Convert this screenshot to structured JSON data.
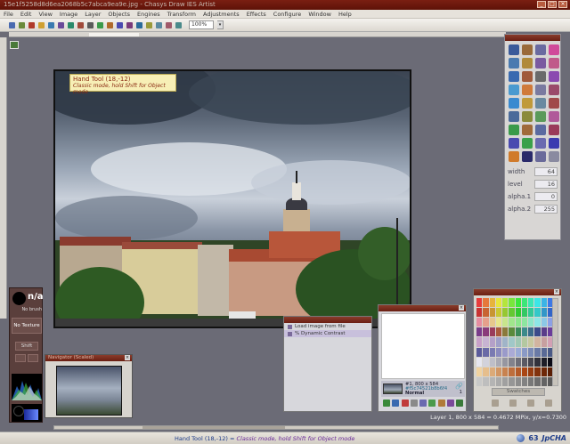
{
  "app": {
    "title": "15e1f5258d8d6ea2068b5c7abca9ea9e.jpg - Chasys Draw IES Artist",
    "window_buttons": [
      "_",
      "□",
      "×"
    ]
  },
  "menu": [
    "File",
    "Edit",
    "View",
    "Image",
    "Layer",
    "Objects",
    "Engines",
    "Transform",
    "Adjustments",
    "Effects",
    "Configure",
    "Window",
    "Help"
  ],
  "toolbar": {
    "zoom": "100%",
    "button_colors": [
      "#4a6ab0",
      "#6a8a3a",
      "#b03a2a",
      "#d0a030",
      "#3a7ab0",
      "#6a4a9a",
      "#2a8a6a",
      "#a04a3a",
      "#5a5a5a",
      "#3a9a4a",
      "#b06a2a",
      "#4a4ab0",
      "#7a3a7a",
      "#2a6a9a",
      "#9a9a3a",
      "#5a8aa0",
      "#a05a6a",
      "#4a8a8a"
    ]
  },
  "tooltip": {
    "title": "Hand Tool (18,-12)",
    "hint": "Classic mode, hold Shift for Object mode"
  },
  "tools": {
    "icon_colors": [
      "#3a5a9a",
      "#9a6a3a",
      "#6a6aa0",
      "#d04a9a",
      "#4a7ab0",
      "#b08a3a",
      "#7a5aa0",
      "#c05a8a",
      "#3a6ab0",
      "#a05a3a",
      "#6a6a6a",
      "#8a4ab0",
      "#4a9ad0",
      "#d07a3a",
      "#7a7aa0",
      "#9a4a6a",
      "#3a8ad0",
      "#c09a3a",
      "#6a8aa0",
      "#a04a4a",
      "#4a6a9a",
      "#8a8a3a",
      "#5a9a5a",
      "#b05a9a",
      "#3a9a4a",
      "#a06a3a",
      "#5a6aa0",
      "#9a3a5a",
      "#4a4ab0",
      "#3aa04a",
      "#6a6ab0",
      "#3a3ab0",
      "#d07a2a",
      "#2a2a6a",
      "#6a6a9a",
      "#8a8aa0"
    ],
    "params": [
      {
        "label": "width",
        "value": "64"
      },
      {
        "label": "level",
        "value": "16"
      },
      {
        "label": "alpha.1",
        "value": "0"
      },
      {
        "label": "alpha.2",
        "value": "255"
      }
    ]
  },
  "brush": {
    "name": "n/a",
    "status": "No brush",
    "texture": "No Texture",
    "shift_label": "Shift"
  },
  "preview": {
    "title": "Navigator (Scaled)"
  },
  "history": {
    "items": [
      "Load image from file",
      "% Dynamic Contrast"
    ]
  },
  "layers": {
    "entry_id": "#1, 800 x 584",
    "entry_hash": "#f5c74521b8b6f4",
    "entry_mode": "Normal",
    "entry_num": "1",
    "button_colors": [
      "#3a8a3a",
      "#3a6ab0",
      "#c03a3a",
      "#8a8a8a",
      "#6a6ab0",
      "#4a9a4a",
      "#b07a3a",
      "#7a4a9a",
      "#3a7a3a"
    ]
  },
  "swatches": {
    "label": "Swatches",
    "colors": [
      "#e63c3c",
      "#e6783c",
      "#e6b43c",
      "#e6e63c",
      "#b4e63c",
      "#78e63c",
      "#3ce63c",
      "#3ce678",
      "#3ce6b4",
      "#3ce6e6",
      "#3cb4e6",
      "#3c78e6",
      "#c83232",
      "#c86432",
      "#c89632",
      "#c8c832",
      "#96c832",
      "#64c832",
      "#32c832",
      "#32c864",
      "#32c896",
      "#32c8c8",
      "#3296c8",
      "#3264c8",
      "#e68ca0",
      "#e6a08c",
      "#e6c88c",
      "#e6e68c",
      "#c8e68c",
      "#a0e68c",
      "#8ce68c",
      "#8ce6a0",
      "#8ce6c8",
      "#8ce6e6",
      "#8cc8e6",
      "#8ca0e6",
      "#7a3c8a",
      "#8a3c7a",
      "#9a3c5a",
      "#aa5a3c",
      "#8a7a3c",
      "#5a8a3c",
      "#3c8a5a",
      "#3c8a8a",
      "#3c6a8a",
      "#3c4a8a",
      "#5a3c8a",
      "#6a3c9a",
      "#c8a0c8",
      "#c8b4d2",
      "#b4a0c8",
      "#a0a0c8",
      "#a0b4c8",
      "#a0c8c8",
      "#a0c8b4",
      "#b4c8a0",
      "#c8c8a0",
      "#d2b4a0",
      "#c8a0a0",
      "#d2a0b4",
      "#5a5a9a",
      "#6a6aa6",
      "#7a7ab2",
      "#8a8abe",
      "#9a9aca",
      "#aaaad6",
      "#9aaad6",
      "#8a9ac6",
      "#7a8ab6",
      "#6a7aa6",
      "#5a6a96",
      "#4a5a86",
      "#e6e6f0",
      "#d2d2dc",
      "#bebec8",
      "#aaaab4",
      "#9696a0",
      "#82828c",
      "#6e6e78",
      "#5a5a64",
      "#464650",
      "#32323c",
      "#1e1e28",
      "#0a0a14",
      "#f0d2a0",
      "#e6be8c",
      "#dcaa78",
      "#d29664",
      "#c88250",
      "#be6e3c",
      "#b45a28",
      "#aa4614",
      "#963c10",
      "#82320c",
      "#6e2808",
      "#5a1e04",
      "#c8c8c8",
      "#bebebe",
      "#b4b4b4",
      "#aaaaaa",
      "#a0a0a0",
      "#969696",
      "#8c8c8c",
      "#828282",
      "#787878",
      "#6e6e6e",
      "#646464",
      "#5a5a5a"
    ],
    "button_colors": [
      "#a99f90",
      "#a99f90",
      "#a99f90",
      "#a99f90"
    ]
  },
  "status": {
    "layer_info": "Layer 1, 800 x 584 = 0.4672 MPix, y/x=0.7300",
    "message_prefix": "Hand Tool (18,-12) = ",
    "message_mode": "Classic mode, hold Shift for Object mode",
    "count": "63",
    "brand": "JpCHA"
  }
}
